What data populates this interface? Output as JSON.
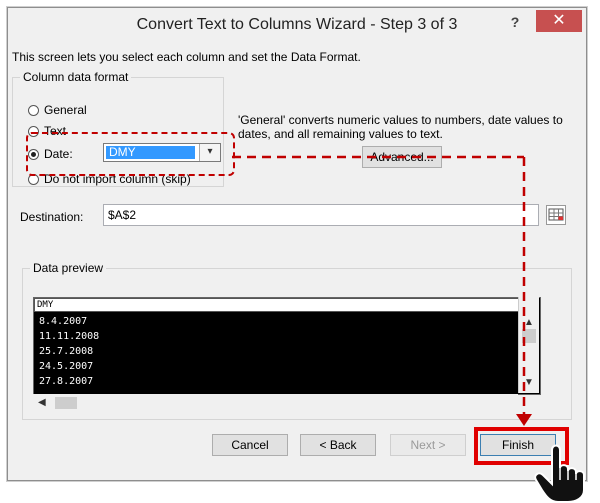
{
  "window": {
    "title": "Convert Text to Columns Wizard - Step 3 of 3",
    "help_label": "?",
    "close_label": "✕"
  },
  "description": "This screen lets you select each column and set the Data Format.",
  "column_format": {
    "group_title": "Column data format",
    "options": [
      {
        "label": "General",
        "selected": false
      },
      {
        "label": "Text",
        "selected": false
      },
      {
        "label": "Date:",
        "selected": true
      },
      {
        "label": "Do not import column (skip)",
        "selected": false
      }
    ],
    "date_format_value": "DMY",
    "dropdown_glyph": "▾"
  },
  "hint_text": "'General' converts numeric values to numbers, date values to dates, and all remaining values to text.",
  "advanced_label": "Advanced...",
  "destination": {
    "label": "Destination:",
    "value": "$A$2"
  },
  "data_preview": {
    "title": "Data preview",
    "header": "DMY",
    "rows": [
      "8.4.2007",
      "11.11.2008",
      "25.7.2008",
      "24.5.2007",
      "27.8.2007"
    ]
  },
  "buttons": {
    "cancel": "Cancel",
    "back": "< Back",
    "next": "Next >",
    "finish": "Finish"
  },
  "colors": {
    "annotation": "#c00000",
    "selection": "#3399ff",
    "close": "#c75050"
  }
}
